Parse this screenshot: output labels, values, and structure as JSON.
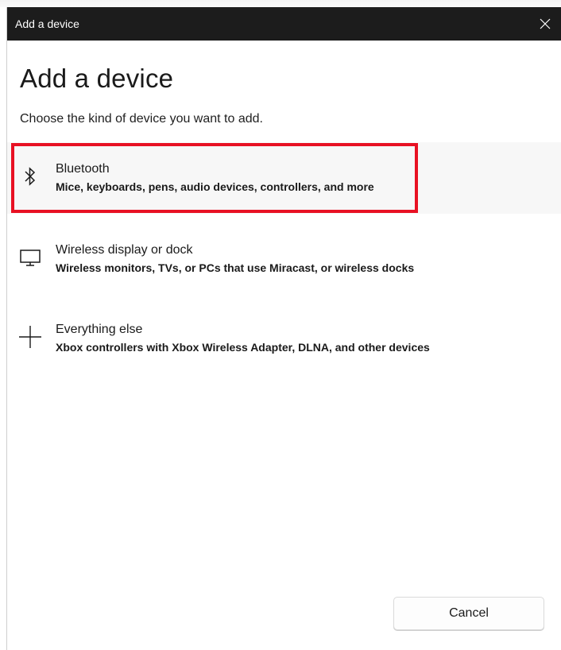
{
  "window": {
    "title": "Add a device",
    "close_icon": "close-icon"
  },
  "page": {
    "heading": "Add a device",
    "subtitle": "Choose the kind of device you want to add."
  },
  "options": [
    {
      "icon": "bluetooth-icon",
      "label": "Bluetooth",
      "description": "Mice, keyboards, pens, audio devices, controllers, and more",
      "selected": true
    },
    {
      "icon": "monitor-icon",
      "label": "Wireless display or dock",
      "description": "Wireless monitors, TVs, or PCs that use Miracast, or wireless docks",
      "selected": false
    },
    {
      "icon": "plus-icon",
      "label": "Everything else",
      "description": "Xbox controllers with Xbox Wireless Adapter, DLNA, and other devices",
      "selected": false
    }
  ],
  "buttons": {
    "cancel": "Cancel"
  },
  "colors": {
    "titlebar": "#1c1c1c",
    "highlight_border": "#e81123",
    "selected_bg": "#f7f7f7"
  }
}
